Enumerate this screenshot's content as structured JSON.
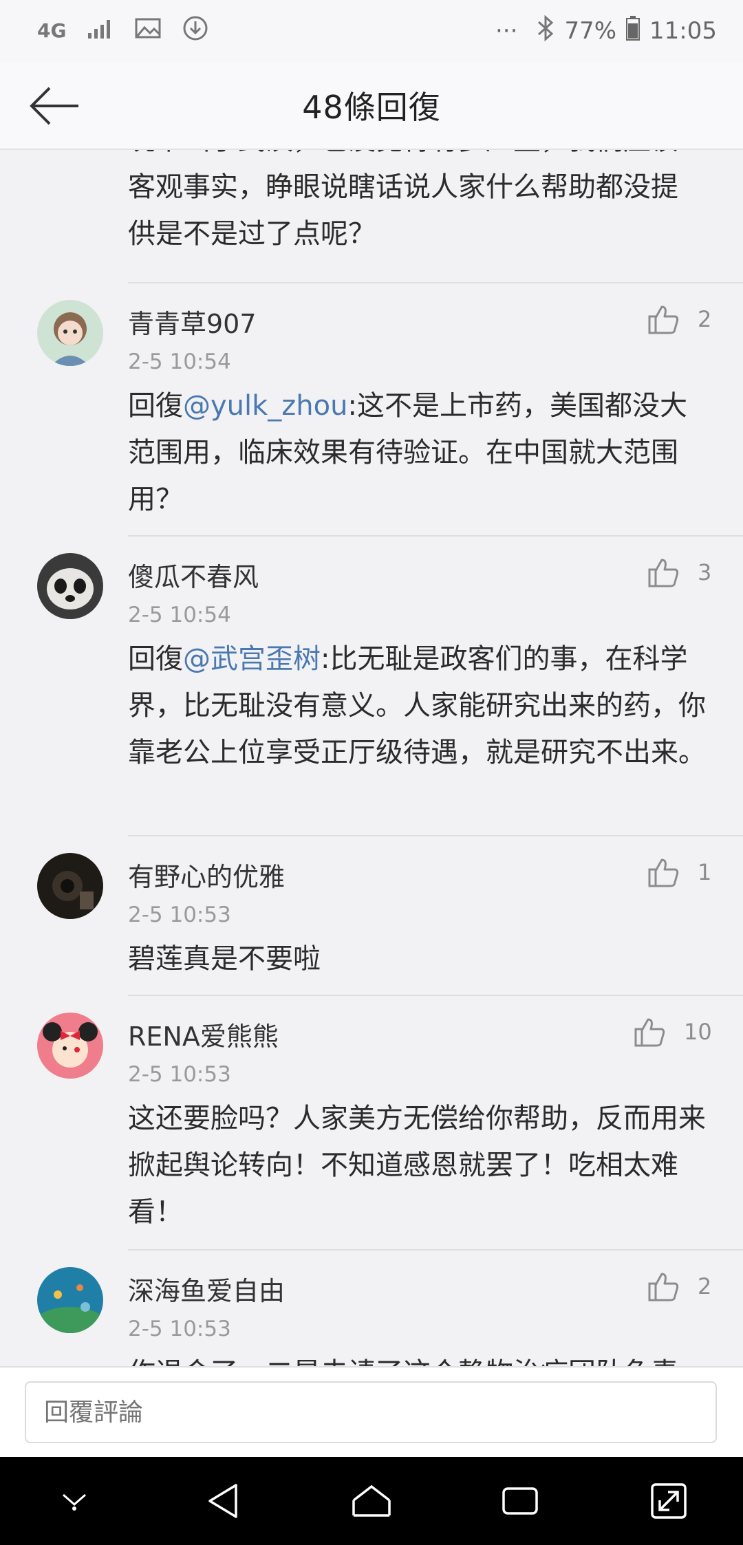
{
  "status_bar": {
    "network": "4G",
    "overflow": "···",
    "battery": "77%",
    "time": "11:05"
  },
  "header": {
    "title": "48條回復"
  },
  "top_fragment": {
    "lines": [
      "况下出了武汉，也没觉得有多严重，我们应该",
      "客观事实，睁眼说瞎话说人家什么帮助都没提",
      "供是不是过了点呢？"
    ]
  },
  "comments": [
    {
      "username": "青青草907",
      "timestamp": "2-5 10:54",
      "likes": "2",
      "reply_prefix": "回復",
      "mention": "@yulk_zhou",
      "text": ":这不是上市药，美国都没大范围用，临床效果有待验证。在中国就大范围用？"
    },
    {
      "username": "傻瓜不春风",
      "timestamp": "2-5 10:54",
      "likes": "3",
      "reply_prefix": "回復",
      "mention": "@武宫歪树",
      "text": ":比无耻是政客们的事，在科学界，比无耻没有意义。人家能研究出来的药，你靠老公上位享受正厅级待遇，就是研究不出来。"
    },
    {
      "username": "有野心的优雅",
      "timestamp": "2-5 10:53",
      "likes": "1",
      "text": "碧莲真是不要啦"
    },
    {
      "username": "RENA爱熊熊",
      "timestamp": "2-5 10:53",
      "likes": "10",
      "text": "这还要脸吗？人家美方无偿给你帮助，反而用来掀起舆论转向！不知道感恩就罢了！吃相太难看！"
    },
    {
      "username": "深海鱼爱自由",
      "timestamp": "2-5 10:53",
      "likes": "2",
      "text": "作退会了，二是去请了这个静物治疗团队负责"
    }
  ],
  "reply_bar": {
    "placeholder": "回覆評論"
  },
  "colors": {
    "mention": "#4a78b0",
    "background": "#f2f2f4",
    "nav_bar": "#000000"
  },
  "icons": [
    "back-arrow-icon",
    "like-icon",
    "avatar",
    "nav-down-icon",
    "nav-back-icon",
    "nav-home-icon",
    "nav-recents-icon",
    "nav-expand-icon"
  ]
}
